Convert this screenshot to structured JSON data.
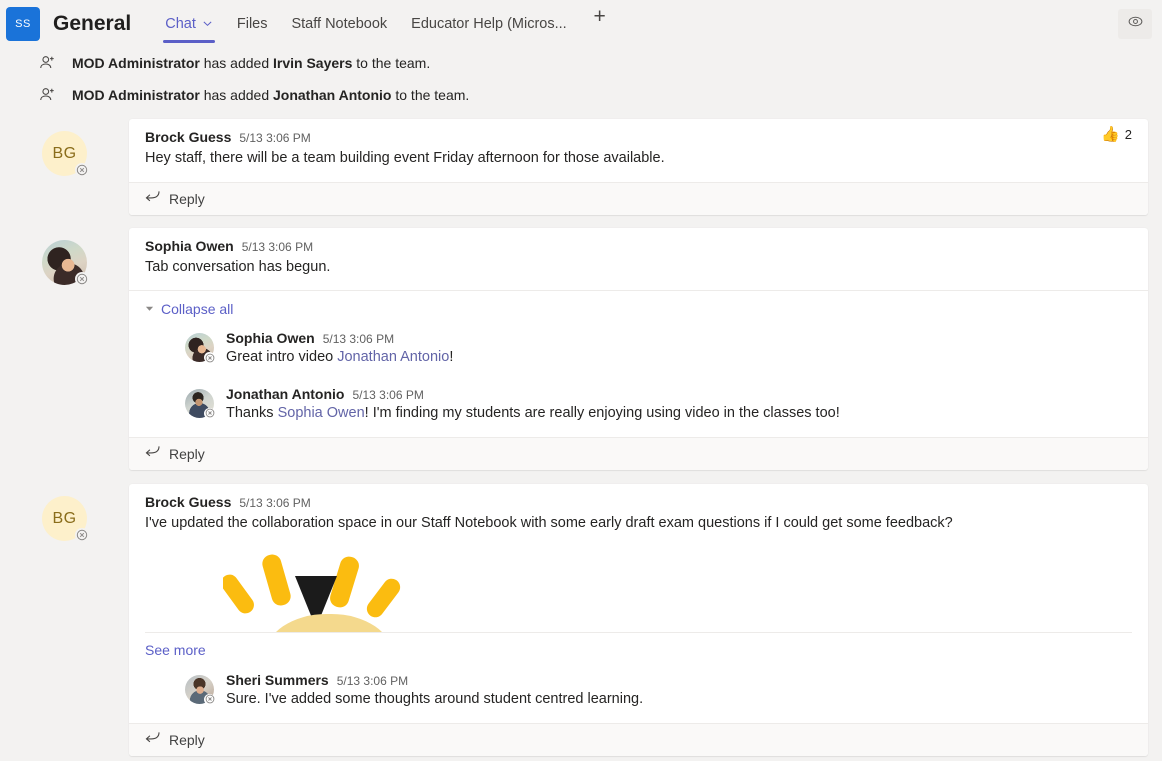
{
  "header": {
    "team_avatar_initials": "SS",
    "channel_title": "General",
    "tabs": [
      {
        "label": "Chat",
        "active": true,
        "has_chevron": true
      },
      {
        "label": "Files",
        "active": false
      },
      {
        "label": "Staff Notebook",
        "active": false
      },
      {
        "label": "Educator Help (Micros...",
        "active": false
      }
    ],
    "add_tab_label": "+",
    "eye_icon": "eye-icon",
    "accent_color": "#5b5fc7",
    "team_avatar_color": "#1a73d9"
  },
  "system_messages": [
    {
      "icon": "add-member-icon",
      "actor": "MOD Administrator",
      "middle": " has added ",
      "target": "Irvin Sayers",
      "suffix": " to the team."
    },
    {
      "icon": "add-member-icon",
      "actor": "MOD Administrator",
      "middle": " has added ",
      "target": "Jonathan Antonio",
      "suffix": " to the team."
    }
  ],
  "messages": [
    {
      "id": "msg-brock-1",
      "author": "Brock Guess",
      "time": "5/13 3:06 PM",
      "avatar_initials": "BG",
      "text": "Hey staff, there will be a team building event Friday afternoon for those available.",
      "reaction": {
        "emoji": "👍",
        "count": "2"
      },
      "reply_label": "Reply"
    },
    {
      "id": "msg-sophia-1",
      "author": "Sophia Owen",
      "time": "5/13 3:06 PM",
      "text": "Tab conversation has begun.",
      "collapse_label": "Collapse all",
      "reply_label": "Reply",
      "thread": [
        {
          "author": "Sophia Owen",
          "time": "5/13 3:06 PM",
          "text_before": "Great intro video ",
          "mention": "Jonathan Antonio",
          "text_after": "!"
        },
        {
          "author": "Jonathan Antonio",
          "time": "5/13 3:06 PM",
          "text_before": "Thanks ",
          "mention": "Sophia Owen",
          "text_after": "! I'm finding my students are really enjoying using video in the classes too!"
        }
      ]
    },
    {
      "id": "msg-brock-2",
      "author": "Brock Guess",
      "time": "5/13 3:06 PM",
      "avatar_initials": "BG",
      "text": "I've updated the collaboration space in our Staff Notebook with some early draft exam questions if I could get some feedback?",
      "sticker": "clapping-sticker",
      "see_more_label": "See more",
      "reply_label": "Reply",
      "thread": [
        {
          "author": "Sheri Summers",
          "time": "5/13 3:06 PM",
          "text_before": "Sure. I've added some thoughts around student centred learning.",
          "mention": "",
          "text_after": ""
        }
      ]
    }
  ]
}
